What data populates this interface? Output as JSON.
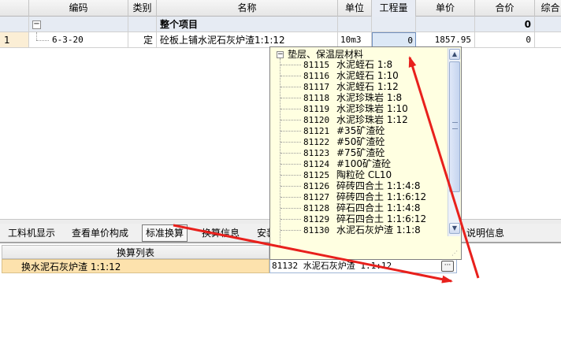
{
  "columns": [
    "编码",
    "类别",
    "名称",
    "单位",
    "工程量",
    "单价",
    "合价",
    "综合"
  ],
  "group_row": {
    "name": "整个项目",
    "total": "0"
  },
  "item_row": {
    "row_number": "1",
    "code": "6-3-20",
    "category": "定",
    "name": "砼板上铺水泥石灰炉渣1:1:12",
    "unit": "10m3",
    "quantity": "0",
    "unit_price": "1857.95",
    "total_price": "0"
  },
  "dropdown": {
    "root_label": "垫层、保温层材料",
    "items": [
      {
        "code": "81115",
        "name": "水泥蛭石 1:8"
      },
      {
        "code": "81116",
        "name": "水泥蛭石 1:10"
      },
      {
        "code": "81117",
        "name": "水泥蛭石 1:12"
      },
      {
        "code": "81118",
        "name": "水泥珍珠岩 1:8"
      },
      {
        "code": "81119",
        "name": "水泥珍珠岩 1:10"
      },
      {
        "code": "81120",
        "name": "水泥珍珠岩 1:12"
      },
      {
        "code": "81121",
        "name": "#35矿渣砼"
      },
      {
        "code": "81122",
        "name": "#50矿渣砼"
      },
      {
        "code": "81123",
        "name": "#75矿渣砼"
      },
      {
        "code": "81124",
        "name": "#100矿渣砼"
      },
      {
        "code": "81125",
        "name": "陶粒砼 CL10"
      },
      {
        "code": "81126",
        "name": "碎砖四合土 1:1:4:8"
      },
      {
        "code": "81127",
        "name": "碎砖四合土 1:1:6:12"
      },
      {
        "code": "81128",
        "name": "碎石四合土 1:1:4:8"
      },
      {
        "code": "81129",
        "name": "碎石四合土 1:1:6:12"
      },
      {
        "code": "81130",
        "name": "水泥石灰炉渣 1:1:8"
      }
    ]
  },
  "tabs": [
    {
      "label": "工料机显示",
      "active": false
    },
    {
      "label": "查看单价构成",
      "active": false
    },
    {
      "label": "标准换算",
      "active": true
    },
    {
      "label": "换算信息",
      "active": false
    },
    {
      "label": "安装",
      "active": false
    },
    {
      "label": "说明信息",
      "active": false
    }
  ],
  "lower_panel": {
    "header": "换算列表",
    "row_label": "换水泥石灰炉渣 1:1:12",
    "close_glyph": "×",
    "editor_value": "81132  水泥石灰炉渣 1:1:12",
    "ellipsis": "···"
  },
  "colors": {
    "annotation_arrow": "#e8201c",
    "dropdown_bg": "#ffffe1",
    "selected_row_bg": "#fde2ad"
  }
}
